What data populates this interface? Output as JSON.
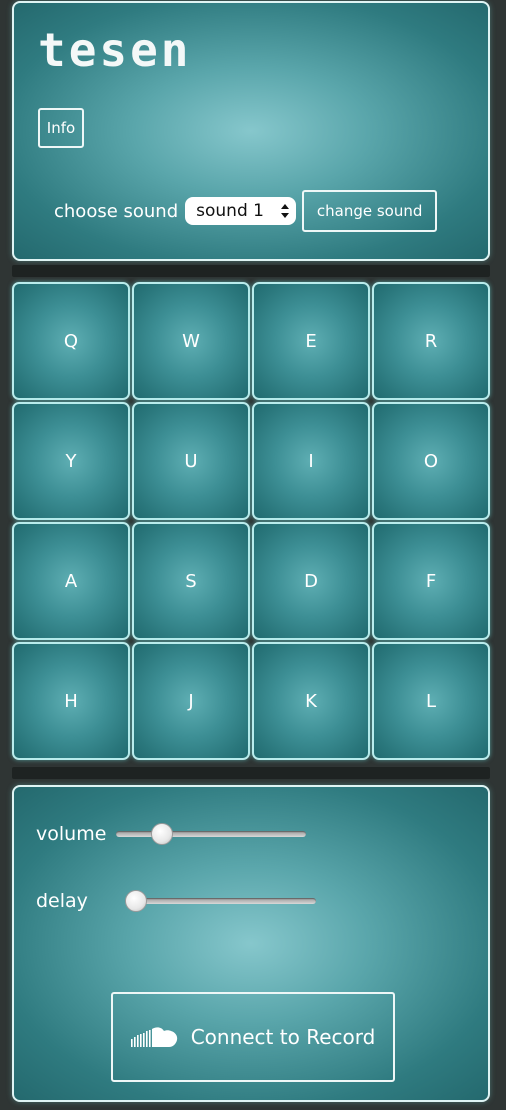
{
  "app": {
    "title": "tesen",
    "info_label": "Info"
  },
  "sound": {
    "label": "choose sound",
    "selected": "sound 1",
    "change_label": "change sound"
  },
  "pads": [
    {
      "key": "Q"
    },
    {
      "key": "W"
    },
    {
      "key": "E"
    },
    {
      "key": "R"
    },
    {
      "key": "Y"
    },
    {
      "key": "U"
    },
    {
      "key": "I"
    },
    {
      "key": "O"
    },
    {
      "key": "A"
    },
    {
      "key": "S"
    },
    {
      "key": "D"
    },
    {
      "key": "F"
    },
    {
      "key": "H"
    },
    {
      "key": "J"
    },
    {
      "key": "K"
    },
    {
      "key": "L"
    }
  ],
  "controls": {
    "volume_label": "volume",
    "volume_value": 0.24,
    "delay_label": "delay",
    "delay_value": 0.05
  },
  "record": {
    "label": "Connect to Record",
    "icon": "soundcloud-icon"
  },
  "colors": {
    "panel_center": "#86c7cc",
    "panel_edge": "#24696e",
    "pad_glow": "#b9ecec",
    "background": "#2f3534"
  }
}
